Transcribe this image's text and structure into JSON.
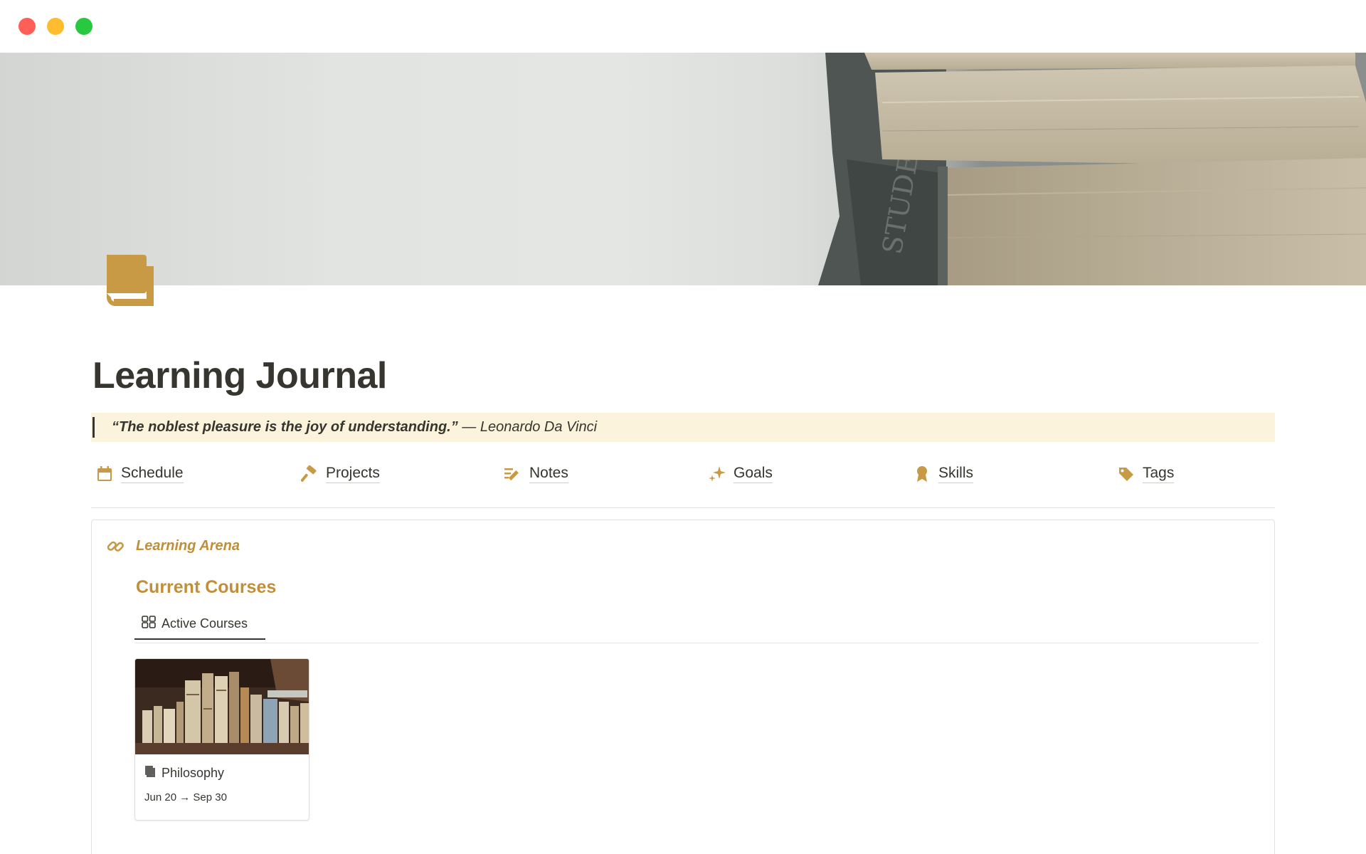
{
  "page": {
    "title": "Learning Journal",
    "quote_main": "“The noblest pleasure is the joy of understanding.”",
    "quote_attribution": " — Leonardo Da Vinci"
  },
  "nav": [
    {
      "label": "Schedule",
      "icon": "calendar-icon"
    },
    {
      "label": "Projects",
      "icon": "hammer-icon"
    },
    {
      "label": "Notes",
      "icon": "list-edit-icon"
    },
    {
      "label": "Goals",
      "icon": "sparkles-icon"
    },
    {
      "label": "Skills",
      "icon": "medal-icon"
    },
    {
      "label": "Tags",
      "icon": "tag-icon"
    }
  ],
  "section": {
    "callout_label": "Learning Arena",
    "heading": "Current Courses",
    "tab_label": "Active Courses"
  },
  "cards": [
    {
      "title": "Philosophy",
      "date": "Jun 20 → Sep 30"
    }
  ],
  "colors": {
    "accent": "#c08f3a",
    "quote_bg": "#fbf3db",
    "text": "#37352f"
  }
}
